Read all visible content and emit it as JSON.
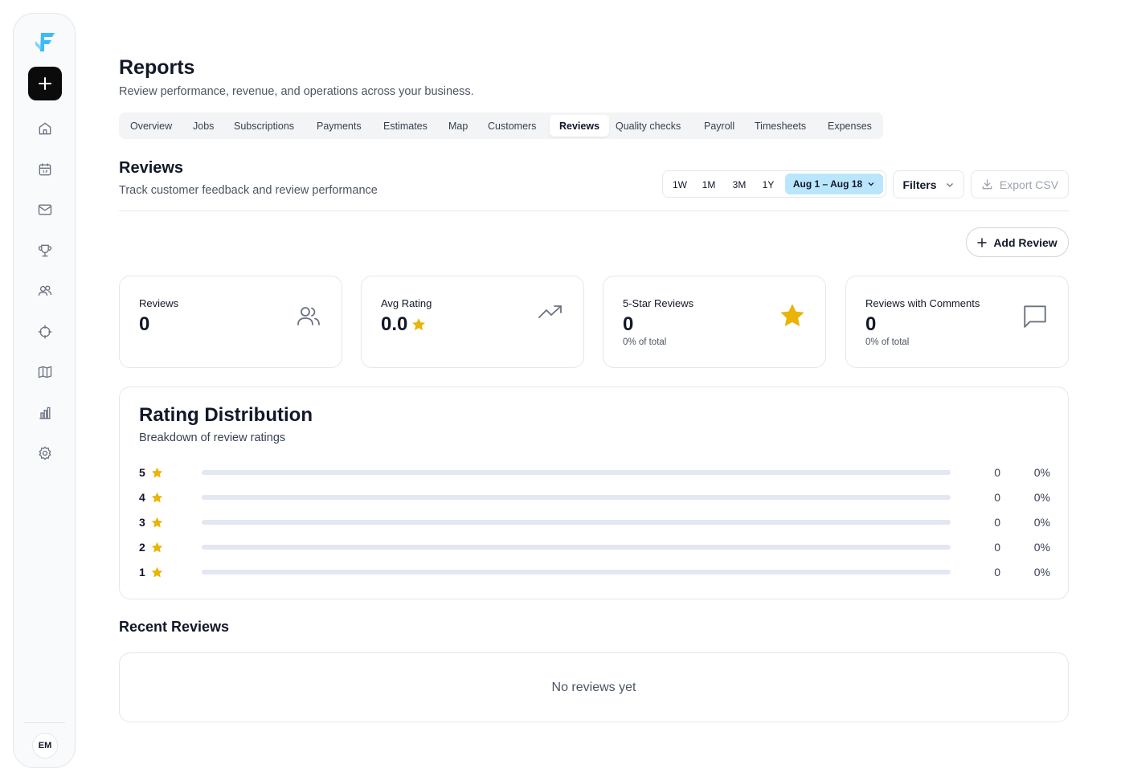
{
  "header": {
    "title": "Reports",
    "subtitle": "Review performance, revenue, and operations across your business."
  },
  "tabs": [
    {
      "label": "Overview"
    },
    {
      "label": "Jobs"
    },
    {
      "label": "Subscriptions"
    },
    {
      "label": "Payments"
    },
    {
      "label": "Estimates"
    },
    {
      "label": "Map"
    },
    {
      "label": "Customers"
    },
    {
      "label": "Reviews",
      "active": true
    },
    {
      "label": "Quality checks"
    },
    {
      "label": "Payroll"
    },
    {
      "label": "Timesheets"
    },
    {
      "label": "Expenses"
    }
  ],
  "section": {
    "title": "Reviews",
    "subtitle": "Track customer feedback and review performance"
  },
  "toolbar": {
    "ranges": [
      "1W",
      "1M",
      "3M",
      "1Y"
    ],
    "date_range": "Aug 1 – Aug 18",
    "filters_label": "Filters",
    "export_label": "Export CSV",
    "add_review_label": "Add Review"
  },
  "stats": [
    {
      "label": "Reviews",
      "value": "0",
      "sub": "",
      "icon": "users-icon"
    },
    {
      "label": "Avg Rating",
      "value": "0.0",
      "sub": "",
      "icon": "trending-up-icon"
    },
    {
      "label": "5-Star Reviews",
      "value": "0",
      "sub": "0% of total",
      "icon": "star-icon"
    },
    {
      "label": "Reviews with Comments",
      "value": "0",
      "sub": "0% of total",
      "icon": "message-square-icon"
    }
  ],
  "distribution": {
    "title": "Rating Distribution",
    "subtitle": "Breakdown of review ratings",
    "rows": [
      {
        "rating": "5",
        "count": "0",
        "percent": "0%",
        "fill": 0
      },
      {
        "rating": "4",
        "count": "0",
        "percent": "0%",
        "fill": 0
      },
      {
        "rating": "3",
        "count": "0",
        "percent": "0%",
        "fill": 0
      },
      {
        "rating": "2",
        "count": "0",
        "percent": "0%",
        "fill": 0
      },
      {
        "rating": "1",
        "count": "0",
        "percent": "0%",
        "fill": 0
      }
    ]
  },
  "recent": {
    "title": "Recent Reviews",
    "empty_text": "No reviews yet"
  },
  "sidebar": {
    "avatar_initials": "EM",
    "nav_icons": [
      "home-icon",
      "calendar-icon",
      "mail-icon",
      "trophy-icon",
      "users-icon",
      "crosshair-icon",
      "map-icon",
      "bar-chart-icon",
      "settings-icon"
    ]
  },
  "colors": {
    "accent": "#bae6fd",
    "star": "#eab308",
    "logo": "#38bdf8"
  }
}
